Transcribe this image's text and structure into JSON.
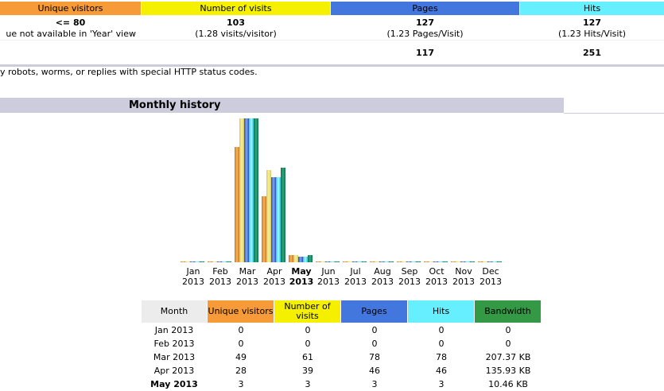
{
  "summary": {
    "headers": [
      "Unique visitors",
      "Number of visits",
      "Pages",
      "Hits"
    ],
    "row1": {
      "unique": "<= 80",
      "unique_note": "ue not available in 'Year' view",
      "visits": "103",
      "visits_note": "(1.28 visits/visitor)",
      "pages": "127",
      "pages_note": "(1.23 Pages/Visit)",
      "hits": "127",
      "hits_note": "(1.23 Hits/Visit)"
    },
    "row2": {
      "pages": "117",
      "hits": "251"
    },
    "footnote": "y robots, worms, or replies with special HTTP status codes."
  },
  "section_title": "Monthly history",
  "colors": {
    "unique": "#F79A38",
    "visits": "#F4F000",
    "pages": "#4477DD",
    "hits": "#66F0FF",
    "bandwidth": "#339944",
    "section": "#CCCCDD"
  },
  "chart_data": {
    "type": "bar",
    "categories": [
      "Jan",
      "Feb",
      "Mar",
      "Apr",
      "May",
      "Jun",
      "Jul",
      "Aug",
      "Sep",
      "Oct",
      "Nov",
      "Dec"
    ],
    "year": "2013",
    "current": "May",
    "series": [
      {
        "name": "Unique visitors",
        "values": [
          0,
          0,
          49,
          28,
          3,
          0,
          0,
          0,
          0,
          0,
          0,
          0
        ]
      },
      {
        "name": "Number of visits",
        "values": [
          0,
          0,
          61,
          39,
          3,
          0,
          0,
          0,
          0,
          0,
          0,
          0
        ]
      },
      {
        "name": "Pages",
        "values": [
          0,
          0,
          78,
          46,
          3,
          0,
          0,
          0,
          0,
          0,
          0,
          0
        ]
      },
      {
        "name": "Hits",
        "values": [
          0,
          0,
          78,
          46,
          3,
          0,
          0,
          0,
          0,
          0,
          0,
          0
        ]
      },
      {
        "name": "Bandwidth (KB)",
        "values": [
          0,
          0,
          207.37,
          135.93,
          10.46,
          0,
          0,
          0,
          0,
          0,
          0,
          0
        ]
      }
    ]
  },
  "table": {
    "headers": [
      "Month",
      "Unique visitors",
      "Number of visits",
      "Pages",
      "Hits",
      "Bandwidth"
    ],
    "rows": [
      [
        "Jan 2013",
        "0",
        "0",
        "0",
        "0",
        "0"
      ],
      [
        "Feb 2013",
        "0",
        "0",
        "0",
        "0",
        "0"
      ],
      [
        "Mar 2013",
        "49",
        "61",
        "78",
        "78",
        "207.37 KB"
      ],
      [
        "Apr 2013",
        "28",
        "39",
        "46",
        "46",
        "135.93 KB"
      ],
      [
        "May 2013",
        "3",
        "3",
        "3",
        "3",
        "10.46 KB"
      ]
    ]
  }
}
